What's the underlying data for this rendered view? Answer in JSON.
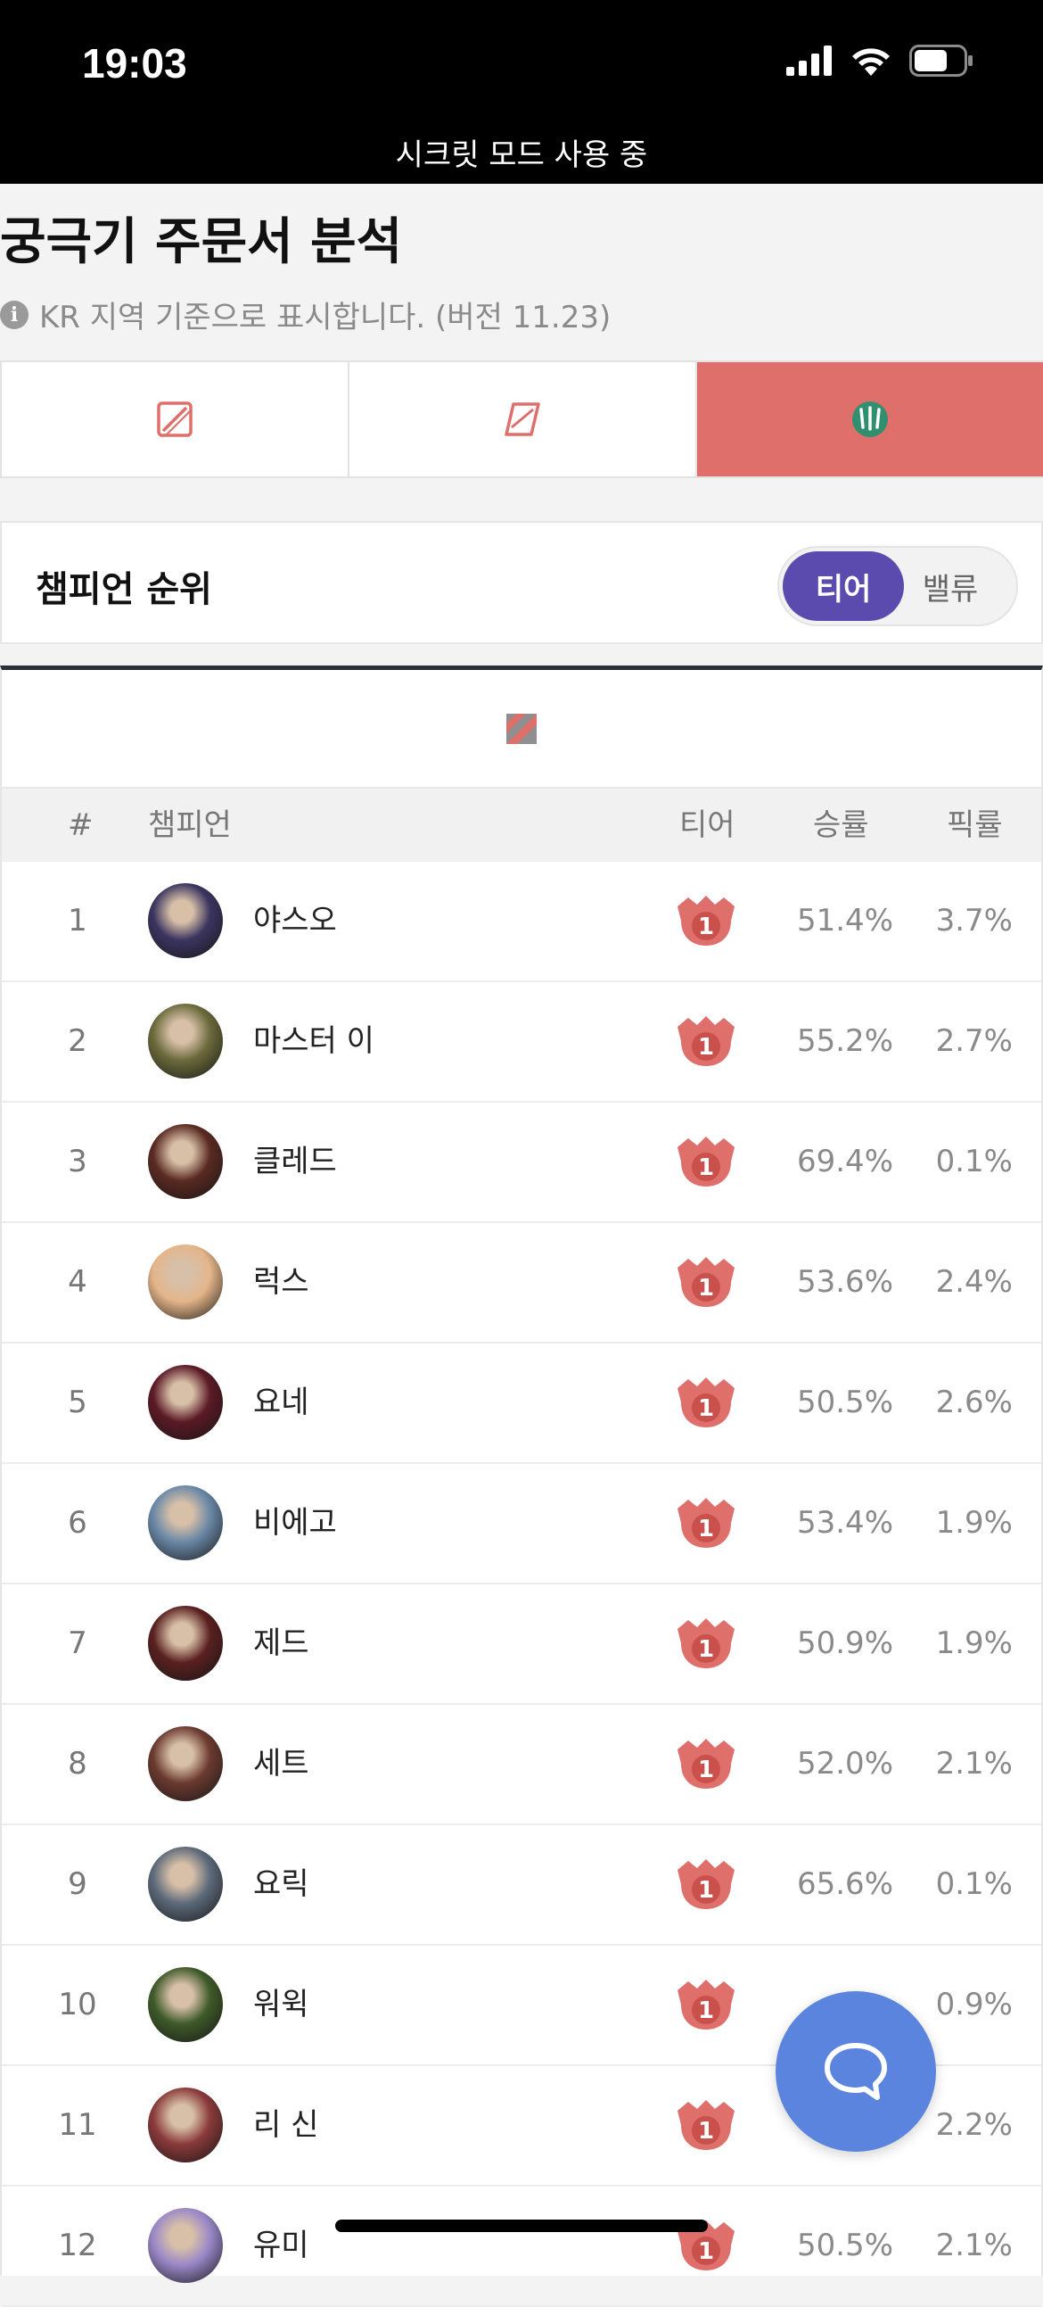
{
  "status_bar": {
    "time": "19:03",
    "subtitle": "시크릿 모드 사용 중"
  },
  "header": {
    "title": "궁극기 주문서 분석",
    "notice": "KR 지역 기준으로 표시합니다. (버전 11.23)",
    "info_icon": "i"
  },
  "tabs": [
    {
      "icon": "scroll-slash-icon",
      "active": false
    },
    {
      "icon": "scroll-icon",
      "active": false
    },
    {
      "icon": "urf-trident-icon",
      "active": true
    }
  ],
  "ranking": {
    "title": "챔피언 순위",
    "toggle": {
      "selected": "티어",
      "other": "밸류"
    }
  },
  "table": {
    "headers": {
      "rank": "#",
      "champion": "챔피언",
      "tier": "티어",
      "winrate": "승률",
      "pickrate": "픽률"
    },
    "rows": [
      {
        "rank": "1",
        "name": "야스오",
        "tier": "1",
        "winrate": "51.4%",
        "pickrate": "3.7%"
      },
      {
        "rank": "2",
        "name": "마스터 이",
        "tier": "1",
        "winrate": "55.2%",
        "pickrate": "2.7%"
      },
      {
        "rank": "3",
        "name": "클레드",
        "tier": "1",
        "winrate": "69.4%",
        "pickrate": "0.1%"
      },
      {
        "rank": "4",
        "name": "럭스",
        "tier": "1",
        "winrate": "53.6%",
        "pickrate": "2.4%"
      },
      {
        "rank": "5",
        "name": "요네",
        "tier": "1",
        "winrate": "50.5%",
        "pickrate": "2.6%"
      },
      {
        "rank": "6",
        "name": "비에고",
        "tier": "1",
        "winrate": "53.4%",
        "pickrate": "1.9%"
      },
      {
        "rank": "7",
        "name": "제드",
        "tier": "1",
        "winrate": "50.9%",
        "pickrate": "1.9%"
      },
      {
        "rank": "8",
        "name": "세트",
        "tier": "1",
        "winrate": "52.0%",
        "pickrate": "2.1%"
      },
      {
        "rank": "9",
        "name": "요릭",
        "tier": "1",
        "winrate": "65.6%",
        "pickrate": "0.1%"
      },
      {
        "rank": "10",
        "name": "워윅",
        "tier": "1",
        "winrate": "",
        "pickrate": "0.9%"
      },
      {
        "rank": "11",
        "name": "리 신",
        "tier": "1",
        "winrate": "",
        "pickrate": "2.2%"
      },
      {
        "rank": "12",
        "name": "유미",
        "tier": "1",
        "winrate": "50.5%",
        "pickrate": "2.1%"
      }
    ]
  },
  "colors": {
    "accent_red": "#de6f6a",
    "toggle_purple": "#5b4bae",
    "chat_blue": "#5a84dd",
    "avatars": [
      "#3b3560",
      "#6b6a3c",
      "#5a2a22",
      "#e4b58a",
      "#5b1a26",
      "#6a88a6",
      "#5a2020",
      "#6b3a30",
      "#5d6a7a",
      "#3f5a2a",
      "#8a3a3a",
      "#9a88c8"
    ]
  }
}
